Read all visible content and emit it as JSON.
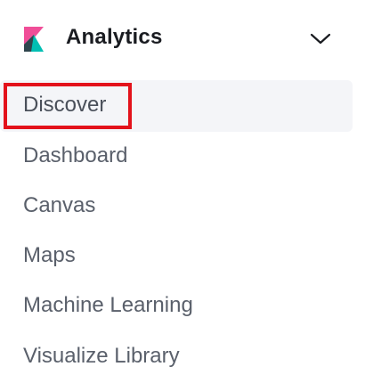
{
  "header": {
    "title": "Analytics",
    "logo_icon": "kibana-logo-icon",
    "toggle_icon": "chevron-down-icon"
  },
  "nav": {
    "items": [
      {
        "label": "Discover",
        "active": true
      },
      {
        "label": "Dashboard",
        "active": false
      },
      {
        "label": "Canvas",
        "active": false
      },
      {
        "label": "Maps",
        "active": false
      },
      {
        "label": "Machine Learning",
        "active": false
      },
      {
        "label": "Visualize Library",
        "active": false
      }
    ]
  },
  "colors": {
    "highlight": "#e3121b",
    "active_bg": "#f4f5f8",
    "text": "#5a606b",
    "title": "#1a1c21",
    "logo_pink": "#f04e98",
    "logo_teal": "#00bfb3",
    "logo_dark": "#343741"
  }
}
